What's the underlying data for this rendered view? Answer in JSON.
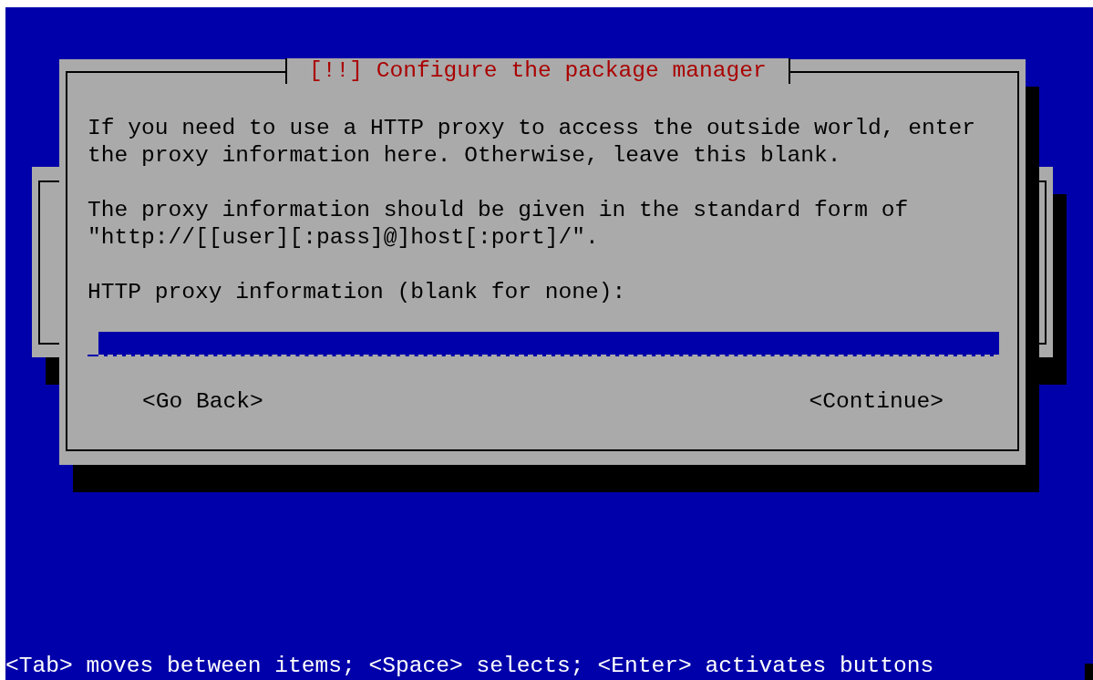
{
  "dialog": {
    "title": "[!!] Configure the package manager",
    "paragraphs": [
      "If you need to use a HTTP proxy to access the outside world, enter the proxy information here. Otherwise, leave this blank.",
      "The proxy information should be given in the standard form of \"http://[[user][:pass]@]host[:port]/\"."
    ],
    "field": {
      "label": "HTTP proxy information (blank for none):"
    },
    "buttons": [
      "<Go Back>",
      "<Continue>"
    ]
  },
  "status_bar": "<Tab> moves between items; <Space> selects; <Enter> activates buttons"
}
